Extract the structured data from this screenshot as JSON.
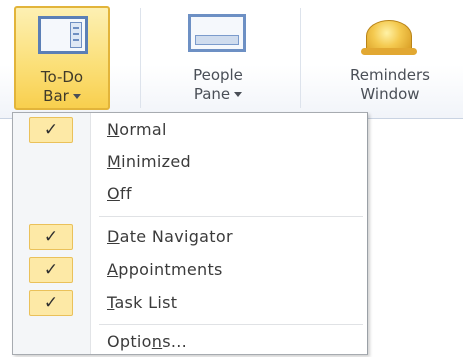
{
  "ribbon": {
    "todo_bar": {
      "label_line1": "To-Do",
      "label_line2": "Bar",
      "icon": "todo-bar-icon",
      "state": "pressed"
    },
    "people_pane": {
      "label_line1": "People",
      "label_line2": "Pane",
      "icon": "people-pane-icon"
    },
    "reminders_window": {
      "label_line1": "Reminders",
      "label_line2": "Window",
      "icon": "bell-icon"
    }
  },
  "menu": {
    "items": [
      {
        "pre": "",
        "accel": "N",
        "post": "ormal",
        "checked": true
      },
      {
        "pre": "",
        "accel": "M",
        "post": "inimized",
        "checked": false
      },
      {
        "pre": "",
        "accel": "O",
        "post": "ff",
        "checked": false
      },
      {
        "pre": "",
        "accel": "D",
        "post": "ate Navigator",
        "checked": true
      },
      {
        "pre": "",
        "accel": "A",
        "post": "ppointments",
        "checked": true
      },
      {
        "pre": "",
        "accel": "T",
        "post": "ask List",
        "checked": true
      },
      {
        "pre": "Optio",
        "accel": "n",
        "post": "s...",
        "checked": false
      }
    ],
    "check_glyph": "✓"
  },
  "colors": {
    "pressed_fill": "#fbe07a",
    "pressed_border": "#e2b43a",
    "check_fill": "#fde9a6",
    "icon_blue": "#5b7fb6"
  }
}
